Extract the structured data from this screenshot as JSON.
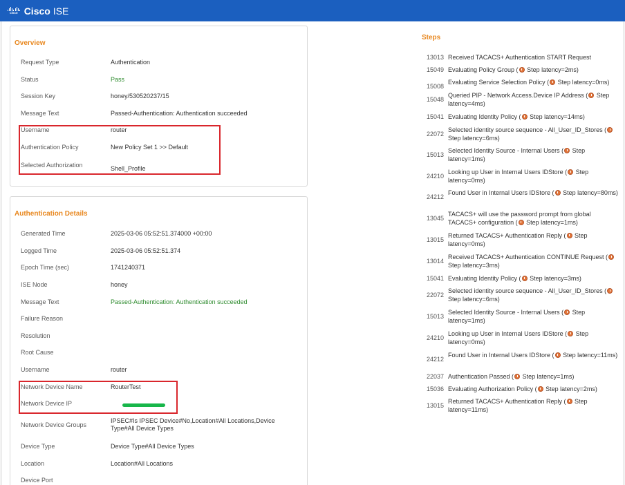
{
  "app": {
    "brand": "Cisco",
    "product": "ISE",
    "logo_text": "cisco"
  },
  "overview": {
    "title": "Overview",
    "rows": [
      {
        "label": "Request Type",
        "value": "Authentication"
      },
      {
        "label": "Status",
        "value": "Pass"
      },
      {
        "label": "Session Key",
        "value": "honey/530520237/15"
      },
      {
        "label": "Message Text",
        "value": "Passed-Authentication: Authentication succeeded"
      },
      {
        "label": "Username",
        "value": "router"
      },
      {
        "label": "Authentication Policy",
        "value": "New Policy Set 1 >> Default"
      },
      {
        "label": "Selected Authorization Profile",
        "value": "Shell_Profile"
      }
    ]
  },
  "auth_details": {
    "title": "Authentication Details",
    "rows": [
      {
        "label": "Generated Time",
        "value": "2025-03-06 05:52:51.374000 +00:00"
      },
      {
        "label": "Logged Time",
        "value": "2025-03-06 05:52:51.374"
      },
      {
        "label": "Epoch Time (sec)",
        "value": "1741240371"
      },
      {
        "label": "ISE Node",
        "value": "honey"
      },
      {
        "label": "Message Text",
        "value": "Passed-Authentication: Authentication succeeded"
      },
      {
        "label": "Failure Reason",
        "value": ""
      },
      {
        "label": "Resolution",
        "value": ""
      },
      {
        "label": "Root Cause",
        "value": ""
      },
      {
        "label": "Username",
        "value": "router"
      },
      {
        "label": "Network Device Name",
        "value": "RouterTest"
      },
      {
        "label": "Network Device IP",
        "value": ""
      },
      {
        "label": "Network Device Groups",
        "value": "IPSEC#Is IPSEC Device#No,Location#All Locations,Device Type#All Device Types"
      },
      {
        "label": "Device Type",
        "value": "Device Type#All Device Types"
      },
      {
        "label": "Location",
        "value": "Location#All Locations"
      },
      {
        "label": "Device Port",
        "value": ""
      }
    ]
  },
  "steps": {
    "title": "Steps",
    "items": [
      {
        "code": "13013",
        "pre": "Received TACACS+ Authentication START Request",
        "post": ""
      },
      {
        "code": "15049",
        "pre": "Evaluating Policy Group (",
        "post": " Step latency=2ms)"
      },
      {
        "code": "15008",
        "pre": "Evaluating Service Selection Policy (",
        "post": " Step latency=0ms)"
      },
      {
        "code": "15048",
        "pre": "Queried PIP - Network Access.Device IP Address (",
        "post": " Step latency=4ms)"
      },
      {
        "code": "15041",
        "pre": "Evaluating Identity Policy (",
        "post": " Step latency=14ms)"
      },
      {
        "code": "22072",
        "pre": "Selected identity source sequence - All_User_ID_Stores (",
        "post": " Step latency=6ms)"
      },
      {
        "code": "15013",
        "pre": "Selected Identity Source - Internal Users (",
        "post": " Step latency=1ms)"
      },
      {
        "code": "24210",
        "pre": "Looking up User in Internal Users IDStore (",
        "post": " Step latency=0ms)"
      },
      {
        "code": "24212",
        "pre": "Found User in Internal Users IDStore (",
        "post": " Step latency=80ms)"
      },
      {
        "code": "13045",
        "pre": "TACACS+ will use the password prompt from global TACACS+ configuration (",
        "post": " Step latency=1ms)"
      },
      {
        "code": "13015",
        "pre": "Returned TACACS+ Authentication Reply (",
        "post": " Step latency=0ms)"
      },
      {
        "code": "13014",
        "pre": "Received TACACS+ Authentication CONTINUE Request (",
        "post": " Step latency=3ms)"
      },
      {
        "code": "15041",
        "pre": "Evaluating Identity Policy (",
        "post": " Step latency=3ms)"
      },
      {
        "code": "22072",
        "pre": "Selected identity source sequence - All_User_ID_Stores (",
        "post": " Step latency=6ms)"
      },
      {
        "code": "15013",
        "pre": "Selected Identity Source - Internal Users (",
        "post": " Step latency=1ms)"
      },
      {
        "code": "24210",
        "pre": "Looking up User in Internal Users IDStore (",
        "post": " Step latency=0ms)"
      },
      {
        "code": "24212",
        "pre": "Found User in Internal Users IDStore (",
        "post": " Step latency=11ms)"
      },
      {
        "code": "22037",
        "pre": "Authentication Passed (",
        "post": " Step latency=1ms)"
      },
      {
        "code": "15036",
        "pre": "Evaluating Authorization Policy (",
        "post": " Step latency=2ms)"
      },
      {
        "code": "13015",
        "pre": "Returned TACACS+ Authentication Reply (",
        "post": " Step latency=11ms)"
      }
    ]
  },
  "colors": {
    "header": "#1b5fbf",
    "section_title": "#e8871e",
    "pass": "#2e8b2e",
    "highlight": "#d9262c",
    "redaction": "#17b64a"
  },
  "icons": {
    "step_latency": "stopwatch-icon"
  }
}
